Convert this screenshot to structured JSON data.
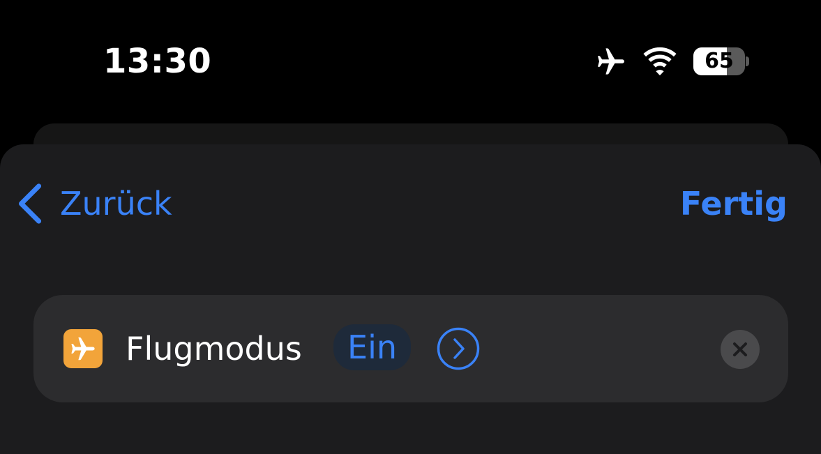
{
  "status_bar": {
    "time": "13:30",
    "battery_level": "65",
    "battery_fraction": 0.65,
    "icons": [
      "airplane-mode-icon",
      "wifi-icon",
      "battery-icon"
    ]
  },
  "nav": {
    "back_label": "Zurück",
    "done_label": "Fertig"
  },
  "action": {
    "app_icon": "airplane-icon",
    "name": "Flugmodus",
    "parameter_value": "Ein",
    "expand_icon": "chevron-right-circle-icon",
    "remove_icon": "close-icon"
  },
  "colors": {
    "accent": "#3a82f7",
    "app_icon_background": "#f2a43a",
    "sheet_background": "#1c1c1e",
    "card_background": "#2c2c2e",
    "screen_background": "#000000"
  }
}
